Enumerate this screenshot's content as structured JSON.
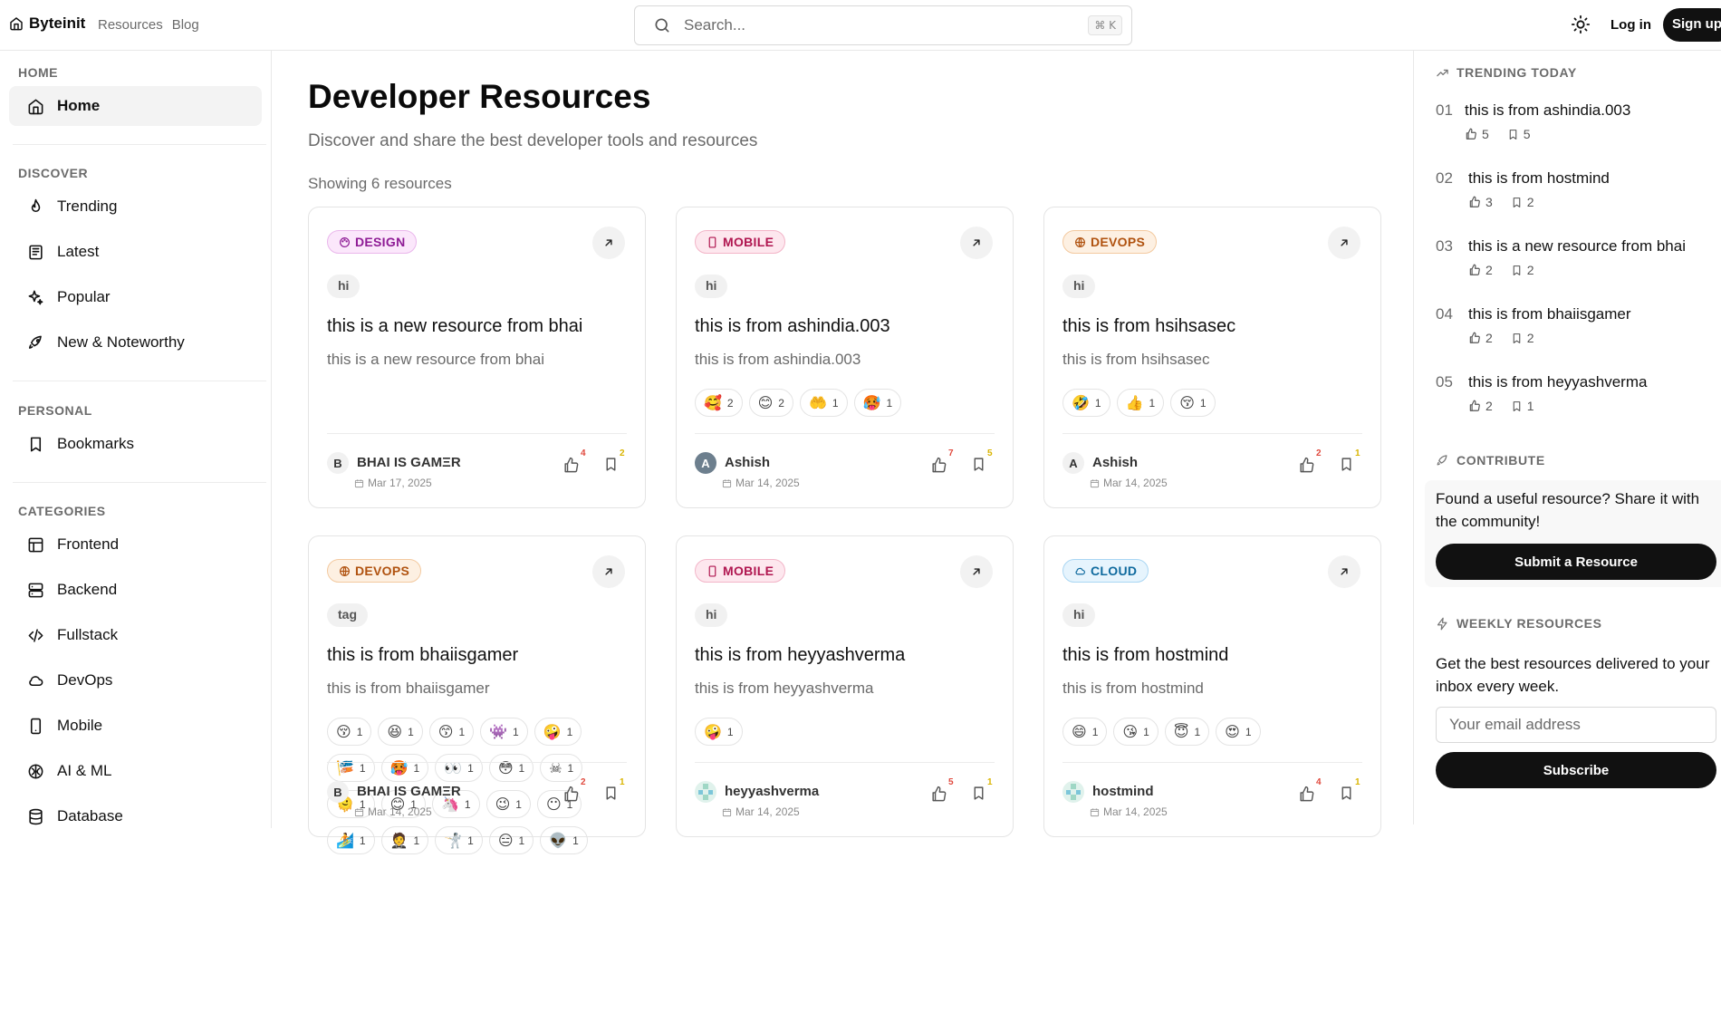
{
  "header": {
    "brand": "Byteinit",
    "nav": [
      "Resources",
      "Blog"
    ],
    "search_placeholder": "Search...",
    "search_shortcut": "⌘ K",
    "login": "Log in",
    "signup": "Sign up"
  },
  "sidebar": {
    "home_title": "HOME",
    "home_item": "Home",
    "discover_title": "DISCOVER",
    "discover": [
      "Trending",
      "Latest",
      "Popular",
      "New & Noteworthy"
    ],
    "personal_title": "PERSONAL",
    "personal": [
      "Bookmarks"
    ],
    "categories_title": "CATEGORIES",
    "categories": [
      "Frontend",
      "Backend",
      "Fullstack",
      "DevOps",
      "Mobile",
      "AI & ML",
      "Database"
    ]
  },
  "main": {
    "title": "Developer Resources",
    "subtitle": "Discover and share the best developer tools and resources",
    "showing": "Showing 6 resources"
  },
  "cards": [
    {
      "category": "DESIGN",
      "tag": "hi",
      "title": "this is a new resource from bhai",
      "description": "this is a new resource from bhai",
      "reactions": [],
      "author_initial": "B",
      "author": "BHAI IS GAMΞR",
      "date": "Mar 17, 2025",
      "likes": "4",
      "bookmarks": "2"
    },
    {
      "category": "MOBILE",
      "tag": "hi",
      "title": "this is from ashindia.003",
      "description": "this is from ashindia.003",
      "reactions": [
        {
          "emoji": "🥰",
          "count": "2"
        },
        {
          "emoji": "😊",
          "count": "2"
        },
        {
          "emoji": "🤲",
          "count": "1"
        },
        {
          "emoji": "🥵",
          "count": "1"
        }
      ],
      "author_initial": "A",
      "author": "Ashish",
      "date": "Mar 14, 2025",
      "likes": "7",
      "bookmarks": "5"
    },
    {
      "category": "DEVOPS",
      "tag": "hi",
      "title": "this is from hsihsasec",
      "description": "this is from hsihsasec",
      "reactions": [
        {
          "emoji": "🤣",
          "count": "1"
        },
        {
          "emoji": "👍",
          "count": "1"
        },
        {
          "emoji": "😚",
          "count": "1"
        }
      ],
      "author_initial": "A",
      "author": "Ashish",
      "date": "Mar 14, 2025",
      "likes": "2",
      "bookmarks": "1"
    },
    {
      "category": "DEVOPS",
      "tag": "tag",
      "title": "this is from bhaiisgamer",
      "description": "this is from bhaiisgamer",
      "reactions": [
        {
          "emoji": "😚",
          "count": "1"
        },
        {
          "emoji": "😆",
          "count": "1"
        },
        {
          "emoji": "😙",
          "count": "1"
        },
        {
          "emoji": "👾",
          "count": "1"
        },
        {
          "emoji": "🤪",
          "count": "1"
        },
        {
          "emoji": "🎏",
          "count": "1"
        },
        {
          "emoji": "🥵",
          "count": "1"
        },
        {
          "emoji": "👀",
          "count": "1"
        },
        {
          "emoji": "😳",
          "count": "1"
        },
        {
          "emoji": "☠",
          "count": "1"
        },
        {
          "emoji": "🫠",
          "count": "1"
        },
        {
          "emoji": "😊",
          "count": "1"
        },
        {
          "emoji": "🦄",
          "count": "1"
        },
        {
          "emoji": "😉",
          "count": "1"
        },
        {
          "emoji": "😶",
          "count": "1"
        },
        {
          "emoji": "🏄",
          "count": "1"
        },
        {
          "emoji": "🤵",
          "count": "1"
        },
        {
          "emoji": "🤺",
          "count": "1"
        },
        {
          "emoji": "😑",
          "count": "1"
        },
        {
          "emoji": "👽",
          "count": "1"
        }
      ],
      "author_initial": "B",
      "author": "BHAI IS GAMΞR",
      "date": "Mar 14, 2025",
      "likes": "2",
      "bookmarks": "1"
    },
    {
      "category": "MOBILE",
      "tag": "hi",
      "title": "this is from heyyashverma",
      "description": "this is from heyyashverma",
      "reactions": [
        {
          "emoji": "🤪",
          "count": "1"
        }
      ],
      "author_initial": "",
      "author": "heyyashverma",
      "date": "Mar 14, 2025",
      "likes": "5",
      "bookmarks": "1"
    },
    {
      "category": "CLOUD",
      "tag": "hi",
      "title": "this is from hostmind",
      "description": "this is from hostmind",
      "reactions": [
        {
          "emoji": "😄",
          "count": "1"
        },
        {
          "emoji": "😘",
          "count": "1"
        },
        {
          "emoji": "😇",
          "count": "1"
        },
        {
          "emoji": "😍",
          "count": "1"
        }
      ],
      "author_initial": "",
      "author": "hostmind",
      "date": "Mar 14, 2025",
      "likes": "4",
      "bookmarks": "1"
    }
  ],
  "rightbar": {
    "trending_title": "TRENDING TODAY",
    "trending": [
      {
        "num": "01",
        "title": "this is from ashindia.003",
        "likes": "5",
        "bookmarks": "5"
      },
      {
        "num": "02",
        "title": "this is from hostmind",
        "likes": "3",
        "bookmarks": "2"
      },
      {
        "num": "03",
        "title": "this is a new resource from bhai",
        "likes": "2",
        "bookmarks": "2"
      },
      {
        "num": "04",
        "title": "this is from bhaiisgamer",
        "likes": "2",
        "bookmarks": "2"
      },
      {
        "num": "05",
        "title": "this is from heyyashverma",
        "likes": "2",
        "bookmarks": "1"
      }
    ],
    "contribute_title": "CONTRIBUTE",
    "contribute_text": "Found a useful resource? Share it with the community!",
    "contribute_button": "Submit a Resource",
    "weekly_title": "WEEKLY RESOURCES",
    "weekly_text": "Get the best resources delivered to your inbox every week.",
    "email_placeholder": "Your email address",
    "subscribe_button": "Subscribe"
  }
}
